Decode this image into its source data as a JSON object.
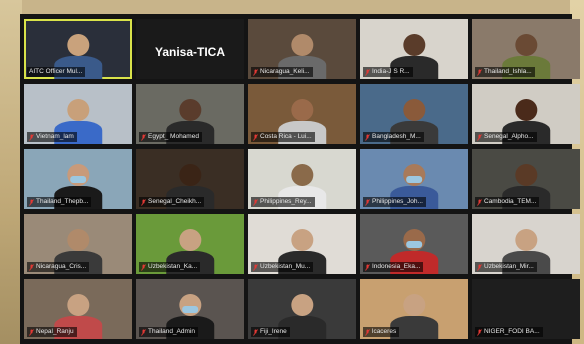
{
  "meeting": {
    "active_speaker_name": "Yanisa-TICA",
    "participants": [
      {
        "label": "AITC Officer Mul...",
        "muted": false
      },
      {
        "label": "Yanisa-TICA",
        "muted": false
      },
      {
        "label": "Nicaragua_Keli...",
        "muted": true
      },
      {
        "label": "India-J S R...",
        "muted": true
      },
      {
        "label": "Thailand_Ishla...",
        "muted": true
      },
      {
        "label": "Vietnam_lam",
        "muted": true
      },
      {
        "label": "Egypt_ Mohamed",
        "muted": true
      },
      {
        "label": "Costa Rica - Lui...",
        "muted": true
      },
      {
        "label": "Bangladesh_M...",
        "muted": true
      },
      {
        "label": "Senegal_Alpho...",
        "muted": true
      },
      {
        "label": "Thailand_Thepb...",
        "muted": true
      },
      {
        "label": "Senegal_Cheikh...",
        "muted": true
      },
      {
        "label": "Philippines_Rey...",
        "muted": true
      },
      {
        "label": "Philippines_Joh...",
        "muted": true
      },
      {
        "label": "Cambodia_TEM...",
        "muted": true
      },
      {
        "label": "Nicaragua_Cris...",
        "muted": true
      },
      {
        "label": "Uzbekistan_Ka...",
        "muted": true
      },
      {
        "label": "Uzbekistan_Mu...",
        "muted": true
      },
      {
        "label": "Indonesia_Eka...",
        "muted": true
      },
      {
        "label": "Uzbekistan_Mir...",
        "muted": true
      },
      {
        "label": "Nepal_Ranju",
        "muted": true
      },
      {
        "label": "Thailand_Admin",
        "muted": true
      },
      {
        "label": "Fiji_Irene",
        "muted": true
      },
      {
        "label": "lcaceres",
        "muted": true
      },
      {
        "label": "NIGER_FODI BA...",
        "muted": true
      }
    ]
  },
  "colors": {
    "active_speaker_border": "#d9e34a",
    "muted_icon": "#e53935",
    "panel_bg": "#141414"
  },
  "icons": {
    "muted": "mic-muted-icon"
  }
}
